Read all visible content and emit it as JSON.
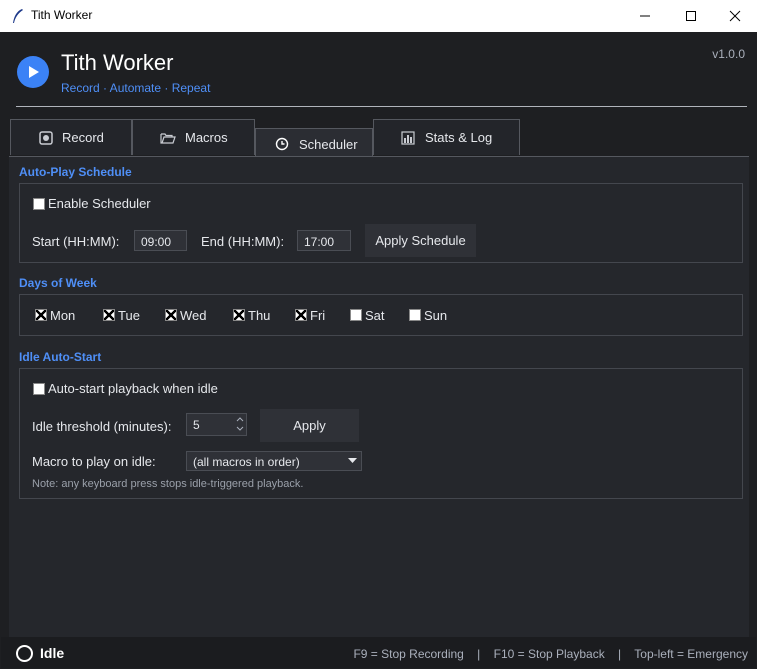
{
  "window": {
    "title": "Tith Worker"
  },
  "header": {
    "title": "Tith Worker",
    "subtitle": "Record · Automate · Repeat",
    "version": "v1.0.0"
  },
  "tabs": [
    {
      "label": "Record",
      "icon": "record-icon"
    },
    {
      "label": "Macros",
      "icon": "folder-icon"
    },
    {
      "label": "Scheduler",
      "icon": "clock-icon",
      "active": true
    },
    {
      "label": "Stats & Log",
      "icon": "bar-chart-icon"
    }
  ],
  "schedule": {
    "title": "Auto-Play Schedule",
    "enable_label": "Enable Scheduler",
    "enabled": false,
    "start_label": "Start (HH:MM):",
    "start_value": "09:00",
    "end_label": "End (HH:MM):",
    "end_value": "17:00",
    "apply_label": "Apply Schedule"
  },
  "days": {
    "title": "Days of Week",
    "items": [
      {
        "label": "Mon",
        "checked": true
      },
      {
        "label": "Tue",
        "checked": true
      },
      {
        "label": "Wed",
        "checked": true
      },
      {
        "label": "Thu",
        "checked": true
      },
      {
        "label": "Fri",
        "checked": true
      },
      {
        "label": "Sat",
        "checked": false
      },
      {
        "label": "Sun",
        "checked": false
      }
    ]
  },
  "idle": {
    "title": "Idle Auto-Start",
    "autostart_label": "Auto-start playback when idle",
    "autostart_checked": false,
    "threshold_label": "Idle threshold (minutes):",
    "threshold_value": "5",
    "apply_label": "Apply",
    "macro_label": "Macro to play on idle:",
    "macro_value": "(all macros in order)",
    "note": "Note: any keyboard press stops idle-triggered playback."
  },
  "status": {
    "text": "Idle",
    "hotkeys": "F9 = Stop Recording    |    F10 = Stop Playback    |    Top-left = Emergency"
  },
  "colors": {
    "accent": "#4f8ff7",
    "background": "#1e1f22",
    "panel": "#25272c"
  }
}
